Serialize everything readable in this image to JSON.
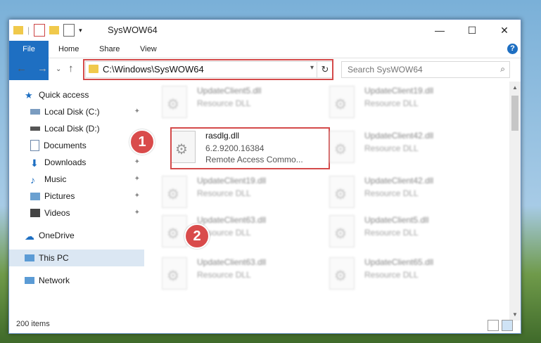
{
  "window": {
    "title": "SysWOW64",
    "minimize": "—",
    "maximize": "☐",
    "close": "✕"
  },
  "ribbon": {
    "tabs": [
      "File",
      "Home",
      "Share",
      "View"
    ],
    "help": "?"
  },
  "nav": {
    "back": "←",
    "forward": "→",
    "recent": "⌄",
    "up": "↑",
    "address": "C:\\Windows\\SysWOW64",
    "refresh": "↻",
    "search_placeholder": "Search SysWOW64"
  },
  "sidebar": {
    "items": [
      {
        "label": "Quick access",
        "pinned": false
      },
      {
        "label": "Local Disk (C:)",
        "pinned": true
      },
      {
        "label": "Local Disk (D:)",
        "pinned": false
      },
      {
        "label": "Documents",
        "pinned": true
      },
      {
        "label": "Downloads",
        "pinned": true
      },
      {
        "label": "Music",
        "pinned": true
      },
      {
        "label": "Pictures",
        "pinned": true
      },
      {
        "label": "Videos",
        "pinned": true
      },
      {
        "label": "OneDrive",
        "pinned": false
      },
      {
        "label": "This PC",
        "pinned": false
      },
      {
        "label": "Network",
        "pinned": false
      }
    ],
    "pin_glyph": "📌"
  },
  "files": [
    {
      "name": "UpdateClient5.dll",
      "desc": "Resource DLL"
    },
    {
      "name": "UpdateClient19.dll",
      "desc": "Resource DLL"
    },
    {
      "name": "rasdlg.dll",
      "desc": "6.2.9200.16384",
      "desc2": "Remote Access Commo..."
    },
    {
      "name": "UpdateClient42.dll",
      "desc": "Resource DLL"
    },
    {
      "name": "UpdateClient19.dll",
      "desc": "Resource DLL"
    },
    {
      "name": "UpdateClient42.dll",
      "desc": "Resource DLL"
    },
    {
      "name": "UpdateClient63.dll",
      "desc": "Resource DLL"
    },
    {
      "name": "UpdateClient5.dll",
      "desc": "Resource DLL"
    },
    {
      "name": "UpdateClient63.dll",
      "desc": "Resource DLL"
    },
    {
      "name": "UpdateClient65.dll",
      "desc": "Resource DLL"
    }
  ],
  "status": {
    "items": "200 items"
  },
  "callouts": [
    "1",
    "2"
  ],
  "colors": {
    "accent": "#1e6fc2",
    "highlight": "#d44a4a",
    "callout": "#d94b4b"
  }
}
